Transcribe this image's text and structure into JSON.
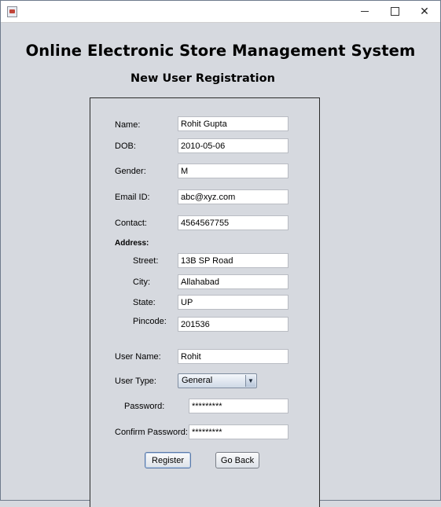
{
  "window": {
    "controls": {
      "minimize_icon": "minimize-icon",
      "maximize_icon": "maximize-icon",
      "close_icon": "close-icon",
      "close_glyph": "✕"
    }
  },
  "app_title": "Online Electronic Store Management System",
  "page_title": "New User Registration",
  "form": {
    "name": {
      "label": "Name:",
      "value": "Rohit Gupta"
    },
    "dob": {
      "label": "DOB:",
      "value": "2010-05-06"
    },
    "gender": {
      "label": "Gender:",
      "value": "M"
    },
    "email": {
      "label": "Email ID:",
      "value": "abc@xyz.com"
    },
    "contact": {
      "label": "Contact:",
      "value": "4564567755"
    },
    "address_heading": "Address:",
    "street": {
      "label": "Street:",
      "value": "13B SP Road"
    },
    "city": {
      "label": "City:",
      "value": "Allahabad"
    },
    "state": {
      "label": "State:",
      "value": "UP"
    },
    "pincode": {
      "label": "Pincode:",
      "value": "201536"
    },
    "username": {
      "label": "User Name:",
      "value": "Rohit"
    },
    "user_type": {
      "label": "User Type:",
      "selected": "General",
      "arrow": "▼"
    },
    "password": {
      "label": "Password:",
      "value": "*********"
    },
    "confirm_password": {
      "label": "Confirm Password:",
      "value": "*********"
    }
  },
  "buttons": {
    "register": "Register",
    "go_back": "Go Back"
  },
  "colors": {
    "background": "#d6d9df",
    "titlebar": "#ffffff",
    "field": "#ffffff"
  }
}
